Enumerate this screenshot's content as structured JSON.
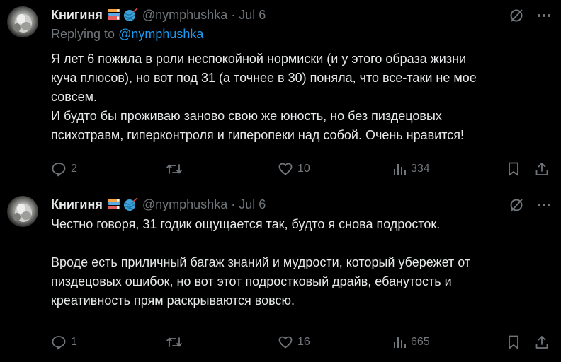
{
  "colors": {
    "background": "#000000",
    "text": "#e7e9ea",
    "muted": "#71767b",
    "link": "#1d9bf0",
    "divider": "#2f3336"
  },
  "tweets": [
    {
      "author_name": "Книгиня",
      "emoji_icons": [
        "books-emoji",
        "yarn-ball-emoji"
      ],
      "handle": "@nymphushka",
      "separator": "·",
      "date": "Jul 6",
      "replying_prefix": "Replying to",
      "replying_to": "@nymphushka",
      "text": "Я лет 6 пожила в роли неспокойной нормиски (и у этого образа жизни\nкуча плюсов), но вот под 31 (а точнее в 30) поняла, что все-таки не мое\nсовсем.\nИ будто бы проживаю заново свою же юность, но без пиздецовых\nпсихотравм, гиперконтроля и гиперопеки над собой. Очень нравится!",
      "replies": "2",
      "retweets": "",
      "likes": "10",
      "views": "334"
    },
    {
      "author_name": "Книгиня",
      "emoji_icons": [
        "books-emoji",
        "yarn-ball-emoji"
      ],
      "handle": "@nymphushka",
      "separator": "·",
      "date": "Jul 6",
      "text": "Честно говоря, 31 годик ощущается так, будто я снова подросток.\n\nВроде есть приличный багаж знаний и мудрости, который убережет от\nпиздецовых ошибок, но вот этот подростковый драйв, ебанутость и\nкреативность прям раскрываются вовсю.",
      "replies": "1",
      "retweets": "",
      "likes": "16",
      "views": "665"
    }
  ]
}
